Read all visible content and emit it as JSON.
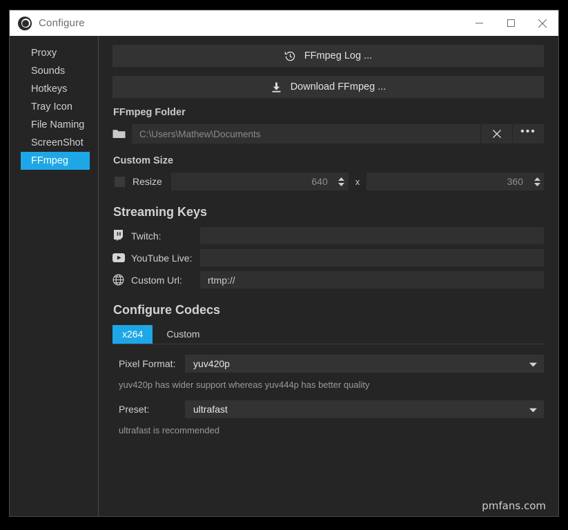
{
  "window": {
    "title": "Configure",
    "app_icon": "captura-logo-icon",
    "controls": {
      "minimize": "minimize-icon",
      "maximize": "maximize-icon",
      "close": "close-icon"
    }
  },
  "sidebar": {
    "items": [
      {
        "label": "Proxy",
        "active": false
      },
      {
        "label": "Sounds",
        "active": false
      },
      {
        "label": "Hotkeys",
        "active": false
      },
      {
        "label": "Tray Icon",
        "active": false
      },
      {
        "label": "File Naming",
        "active": false
      },
      {
        "label": "ScreenShot",
        "active": false
      },
      {
        "label": "FFmpeg",
        "active": true
      }
    ]
  },
  "main": {
    "ffmpeg_log_button": "FFmpeg Log ...",
    "download_ffmpeg_button": "Download FFmpeg ...",
    "folder": {
      "heading": "FFmpeg Folder",
      "path_placeholder": "C:\\Users\\Mathew\\Documents",
      "path_value": "",
      "clear_label": "✕",
      "browse_label": "•••"
    },
    "custom_size": {
      "heading": "Custom Size",
      "resize_label": "Resize",
      "resize_checked": false,
      "width": "640",
      "height": "360",
      "separator": "x"
    },
    "streaming_keys": {
      "heading": "Streaming Keys",
      "rows": [
        {
          "icon": "twitch-icon",
          "label": "Twitch:",
          "value": ""
        },
        {
          "icon": "youtube-icon",
          "label": "YouTube Live:",
          "value": ""
        },
        {
          "icon": "globe-icon",
          "label": "Custom Url:",
          "value": "rtmp://"
        }
      ]
    },
    "codecs": {
      "heading": "Configure Codecs",
      "tabs": [
        {
          "label": "x264",
          "active": true
        },
        {
          "label": "Custom",
          "active": false
        }
      ],
      "pixel_format": {
        "label": "Pixel Format:",
        "value": "yuv420p",
        "hint": "yuv420p has wider support whereas yuv444p has better quality"
      },
      "preset": {
        "label": "Preset:",
        "value": "ultrafast",
        "hint": "ultrafast is recommended"
      }
    }
  },
  "watermark": "pmfans.com",
  "colors": {
    "accent": "#1ea7e6",
    "window_bg": "#252525",
    "field_bg": "#303030",
    "button_bg": "#333333",
    "titlebar_bg": "#ffffff"
  }
}
